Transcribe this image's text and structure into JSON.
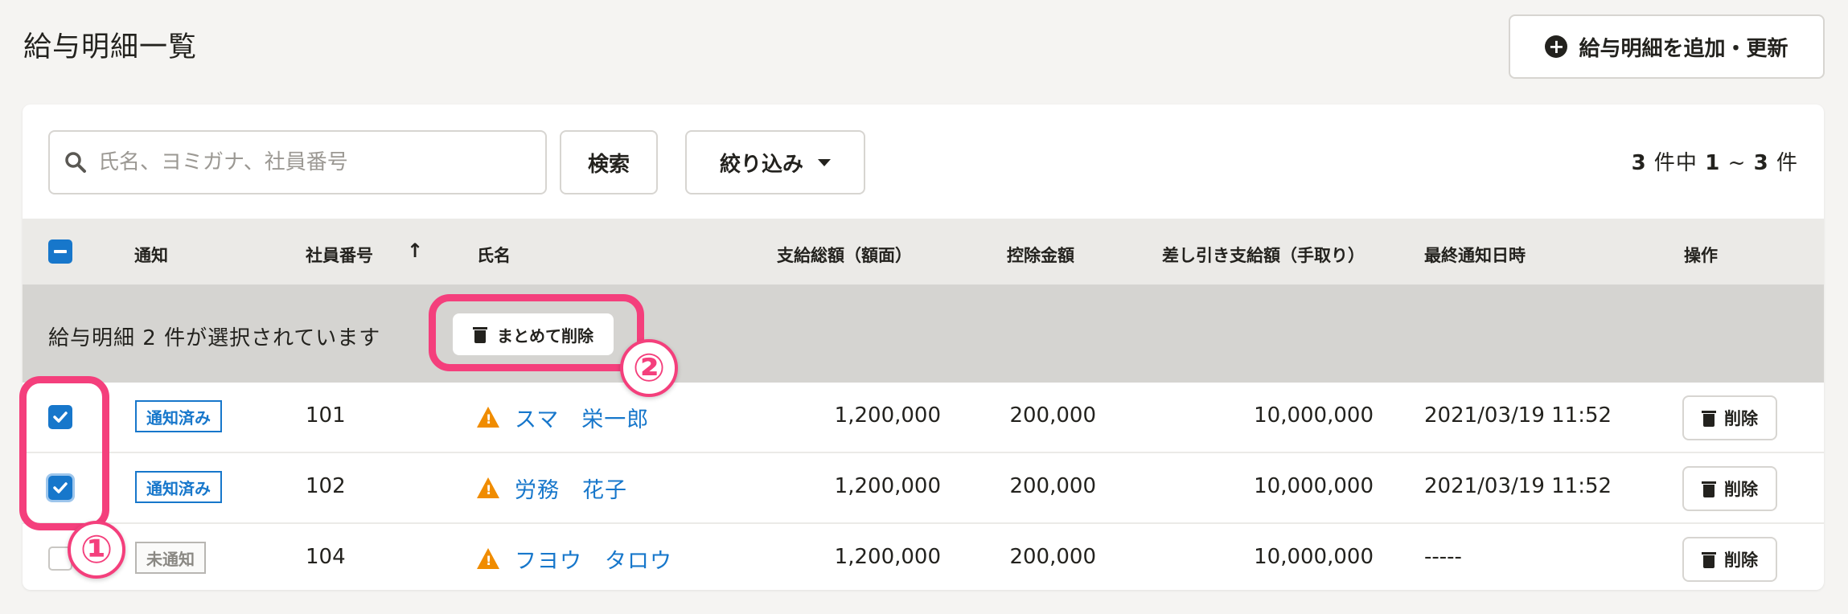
{
  "page": {
    "title": "給与明細一覧"
  },
  "header": {
    "add_button_label": "給与明細を追加・更新"
  },
  "search": {
    "placeholder": "氏名、ヨミガナ、社員番号",
    "value": "",
    "button_label": "検索"
  },
  "filter": {
    "label": "絞り込み"
  },
  "pagination": {
    "total": "3",
    "range_start": "1",
    "range_end": "3",
    "text_total_suffix": "件中",
    "text_suffix": "件",
    "separator": "~"
  },
  "table": {
    "columns": {
      "notice": "通知",
      "employee_no": "社員番号",
      "sort_arrow": "↑",
      "name": "氏名",
      "gross": "支給総額（額面）",
      "deduction": "控除金額",
      "net": "差し引き支給額（手取り）",
      "last_notified": "最終通知日時",
      "actions": "操作"
    },
    "rows": [
      {
        "checked": true,
        "status": "通知済み",
        "status_type": "done",
        "employee_no": "101",
        "name": "スマ　栄一郎",
        "gross": "1,200,000",
        "deduction": "200,000",
        "net": "10,000,000",
        "last_notified": "2021/03/19 11:52",
        "delete_label": "削除"
      },
      {
        "checked": true,
        "status": "通知済み",
        "status_type": "done",
        "employee_no": "102",
        "name": "労務　花子",
        "gross": "1,200,000",
        "deduction": "200,000",
        "net": "10,000,000",
        "last_notified": "2021/03/19 11:52",
        "delete_label": "削除"
      },
      {
        "checked": false,
        "status": "未通知",
        "status_type": "not",
        "employee_no": "104",
        "name": "フヨウ　タロウ",
        "gross": "1,200,000",
        "deduction": "200,000",
        "net": "10,000,000",
        "last_notified": "-----",
        "delete_label": "削除"
      }
    ]
  },
  "bulk": {
    "selected_text": "給与明細 2 件が選択されています",
    "delete_label": "まとめて削除"
  },
  "annotations": {
    "marker1": "①",
    "marker2": "②"
  },
  "colors": {
    "accent": "#1777cb",
    "highlight": "#f43f7c",
    "warning": "#f08c00"
  },
  "icons": {
    "add": "plus-circle-icon",
    "search": "search-icon",
    "filter": "caret-down-icon",
    "trash": "trash-icon",
    "warning": "warning-icon",
    "check": "check-icon"
  }
}
